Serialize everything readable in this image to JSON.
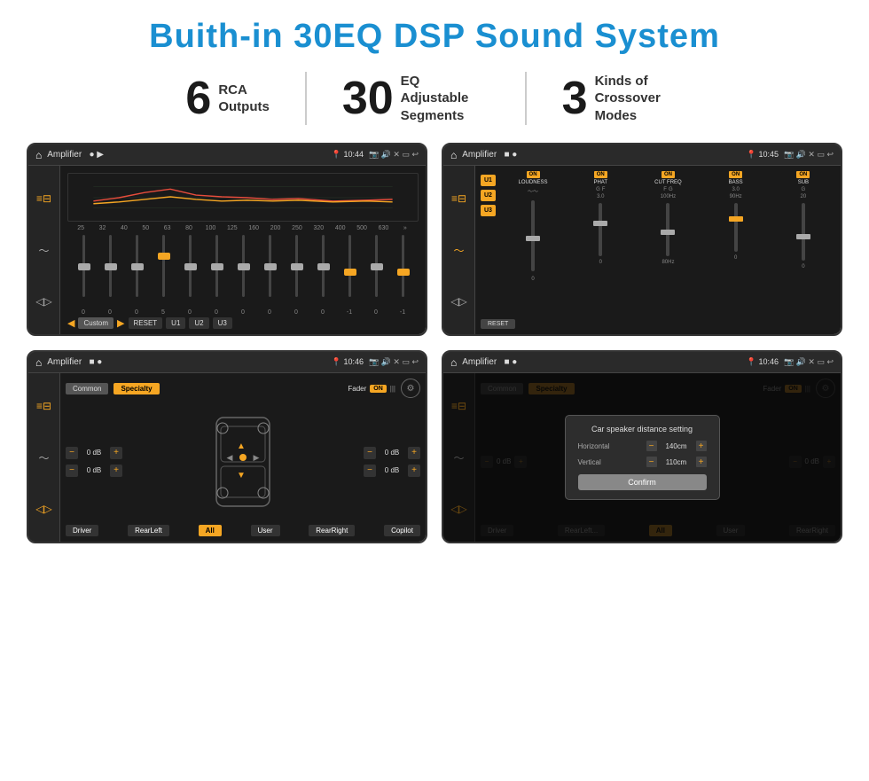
{
  "page": {
    "title": "Buith-in 30EQ DSP Sound System",
    "background": "#ffffff"
  },
  "stats": [
    {
      "number": "6",
      "label": "RCA\nOutputs"
    },
    {
      "number": "30",
      "label": "EQ Adjustable\nSegments"
    },
    {
      "number": "3",
      "label": "Kinds of\nCrossover Modes"
    }
  ],
  "screens": [
    {
      "id": "eq-screen",
      "topbar": {
        "app": "Amplifier",
        "time": "10:44"
      }
    },
    {
      "id": "amp2-screen",
      "topbar": {
        "app": "Amplifier",
        "time": "10:45"
      }
    },
    {
      "id": "cross-screen",
      "topbar": {
        "app": "Amplifier",
        "time": "10:46"
      }
    },
    {
      "id": "dialog-screen",
      "topbar": {
        "app": "Amplifier",
        "time": "10:46"
      },
      "dialog": {
        "title": "Car speaker distance setting",
        "horizontal_label": "Horizontal",
        "horizontal_value": "140cm",
        "vertical_label": "Vertical",
        "vertical_value": "110cm",
        "confirm_label": "Confirm"
      }
    }
  ],
  "eq": {
    "bands": [
      "25",
      "32",
      "40",
      "50",
      "63",
      "80",
      "100",
      "125",
      "160",
      "200",
      "250",
      "320",
      "400",
      "500",
      "630"
    ],
    "values": [
      "0",
      "0",
      "0",
      "5",
      "0",
      "0",
      "0",
      "0",
      "0",
      "0",
      "-1",
      "0",
      "-1"
    ],
    "presets": [
      "Custom",
      "RESET",
      "U1",
      "U2",
      "U3"
    ]
  },
  "amp2": {
    "presets": [
      "U1",
      "U2",
      "U3"
    ],
    "channels": [
      "LOUDNESS",
      "PHAT",
      "CUT FREQ",
      "BASS",
      "SUB"
    ],
    "reset": "RESET"
  },
  "crossover": {
    "tabs": [
      "Common",
      "Specialty"
    ],
    "fader": "Fader",
    "on": "ON",
    "buttons": [
      "Driver",
      "RearLeft",
      "All",
      "User",
      "RearRight",
      "Copilot"
    ],
    "vol_default": "0 dB"
  },
  "dialog": {
    "title": "Car speaker distance setting",
    "horizontal": "Horizontal",
    "horizontal_val": "140cm",
    "vertical": "Vertical",
    "vertical_val": "110cm",
    "confirm": "Confirm"
  }
}
